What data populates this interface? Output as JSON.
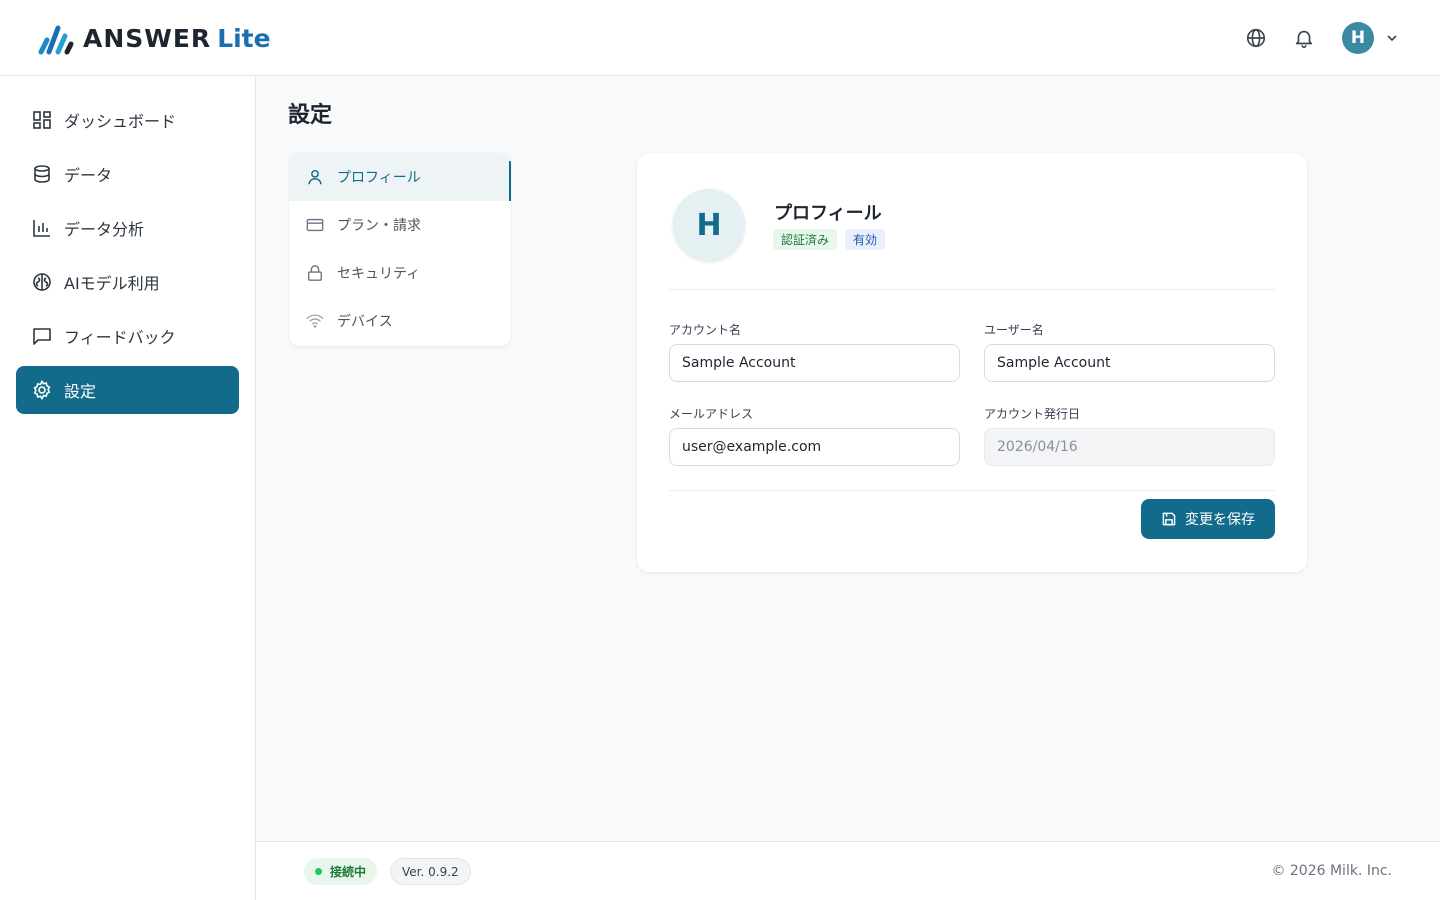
{
  "header": {
    "logo_main": "ANSWER",
    "logo_sub": "Lite",
    "avatar_initial": "H"
  },
  "sidebar": {
    "items": [
      {
        "label": "ダッシュボード",
        "icon": "dashboard-icon"
      },
      {
        "label": "データ",
        "icon": "database-icon"
      },
      {
        "label": "データ分析",
        "icon": "bar-chart-icon"
      },
      {
        "label": "AIモデル利用",
        "icon": "brain-icon"
      },
      {
        "label": "フィードバック",
        "icon": "message-icon"
      },
      {
        "label": "設定",
        "icon": "gear-icon",
        "active": true
      }
    ]
  },
  "main": {
    "title": "設定",
    "subnav": [
      {
        "label": "プロフィール",
        "icon": "user-icon",
        "active": true
      },
      {
        "label": "プラン・請求",
        "icon": "credit-card-icon"
      },
      {
        "label": "セキュリティ",
        "icon": "lock-icon"
      },
      {
        "label": "デバイス",
        "icon": "wifi-icon"
      }
    ],
    "profile": {
      "avatar_initial": "H",
      "title": "プロフィール",
      "badge_verified": "認証済み",
      "badge_active": "有効",
      "fields": {
        "account_name_label": "アカウント名",
        "account_name_value": "Sample Account",
        "username_label": "ユーザー名",
        "username_value": "Sample Account",
        "email_label": "メールアドレス",
        "email_value": "user@example.com",
        "issued_label": "アカウント発行日",
        "issued_value": "2026/04/16"
      },
      "save_label": "変更を保存"
    }
  },
  "footer": {
    "status": "接続中",
    "version": "Ver. 0.9.2",
    "copyright": "© 2026 Milk. Inc."
  },
  "colors": {
    "accent": "#136b8c",
    "brand_blue": "#1a6fb0",
    "success": "#22c55e"
  }
}
